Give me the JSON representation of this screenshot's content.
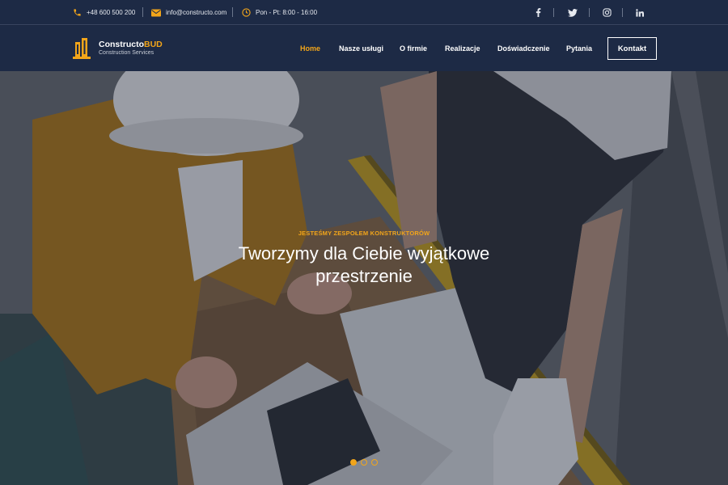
{
  "topbar": {
    "phone": "+48 600 500 200",
    "email": "info@constructo.com",
    "hours": "Pon - Pt: 8:00 - 16:00",
    "social": [
      {
        "label": "f",
        "icon": "facebook-icon"
      },
      {
        "label": "twitter",
        "icon": "twitter-icon"
      },
      {
        "label": "instagram",
        "icon": "instagram-icon"
      },
      {
        "label": "in",
        "icon": "linkedin-icon"
      }
    ]
  },
  "brand": {
    "name_main": "Constructo",
    "name_accent": "BUD",
    "tagline": "Construction Services",
    "accent_color": "#f2a51a"
  },
  "nav": {
    "items": [
      {
        "label": "Home",
        "active": true
      },
      {
        "label": "Nasze usługi",
        "active": false
      },
      {
        "label": "O firmie",
        "active": false
      },
      {
        "label": "Realizacje",
        "active": false
      },
      {
        "label": "Doświadczenie",
        "active": false
      },
      {
        "label": "Pytania",
        "active": false
      }
    ],
    "contact_label": "Kontakt"
  },
  "hero": {
    "kicker": "JESTEŚMY ZESPOŁEM KONSTRUKTORÓW",
    "headline": "Tworzymy dla Ciebie wyjątkowe przestrzenie",
    "slides_total": 3,
    "active_slide": 1
  }
}
